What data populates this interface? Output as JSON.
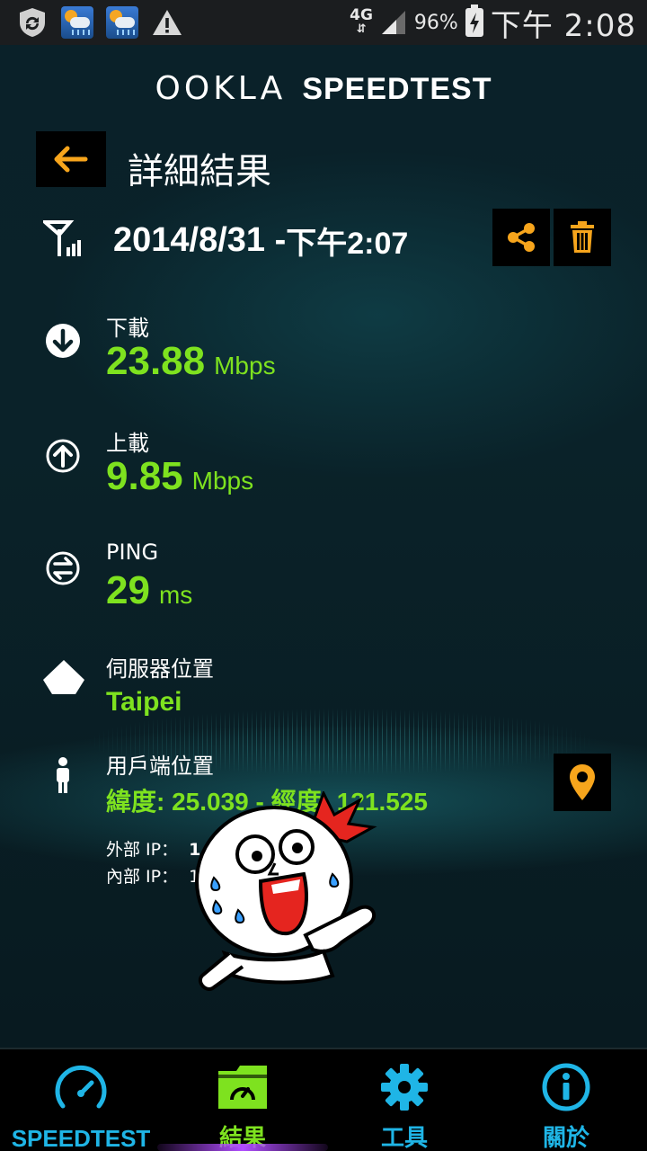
{
  "status_bar": {
    "network": "4G",
    "battery": "96%",
    "time": "下午 2:08"
  },
  "header": {
    "logo_ookla": "OOKLA",
    "logo_speedtest": "SPEEDTEST"
  },
  "page": {
    "title": "詳細結果"
  },
  "test": {
    "date": "2014/8/31 - ",
    "time": "下午2:07"
  },
  "download": {
    "label": "下載",
    "value": "23.88",
    "unit": "Mbps"
  },
  "upload": {
    "label": "上載",
    "value": "9.85",
    "unit": "Mbps"
  },
  "ping": {
    "label": "PING",
    "value": "29",
    "unit": "ms"
  },
  "server": {
    "label": "伺服器位置",
    "value": "Taipei"
  },
  "client": {
    "label": "用戶端位置",
    "coords": "緯度: 25.039 - 經度: 121.525",
    "external_ip_label": "外部 IP：",
    "external_ip": "1",
    "internal_ip_label": "內部 IP：",
    "internal_ip": "1"
  },
  "nav": [
    {
      "label": "SPEEDTEST",
      "icon": "speedometer-icon"
    },
    {
      "label": "結果",
      "icon": "results-folder-icon"
    },
    {
      "label": "工具",
      "icon": "gear-icon"
    },
    {
      "label": "關於",
      "icon": "info-icon"
    }
  ],
  "colors": {
    "accent_green": "#7ee21f",
    "accent_orange": "#f7a51c",
    "accent_blue": "#1fb5e6"
  }
}
